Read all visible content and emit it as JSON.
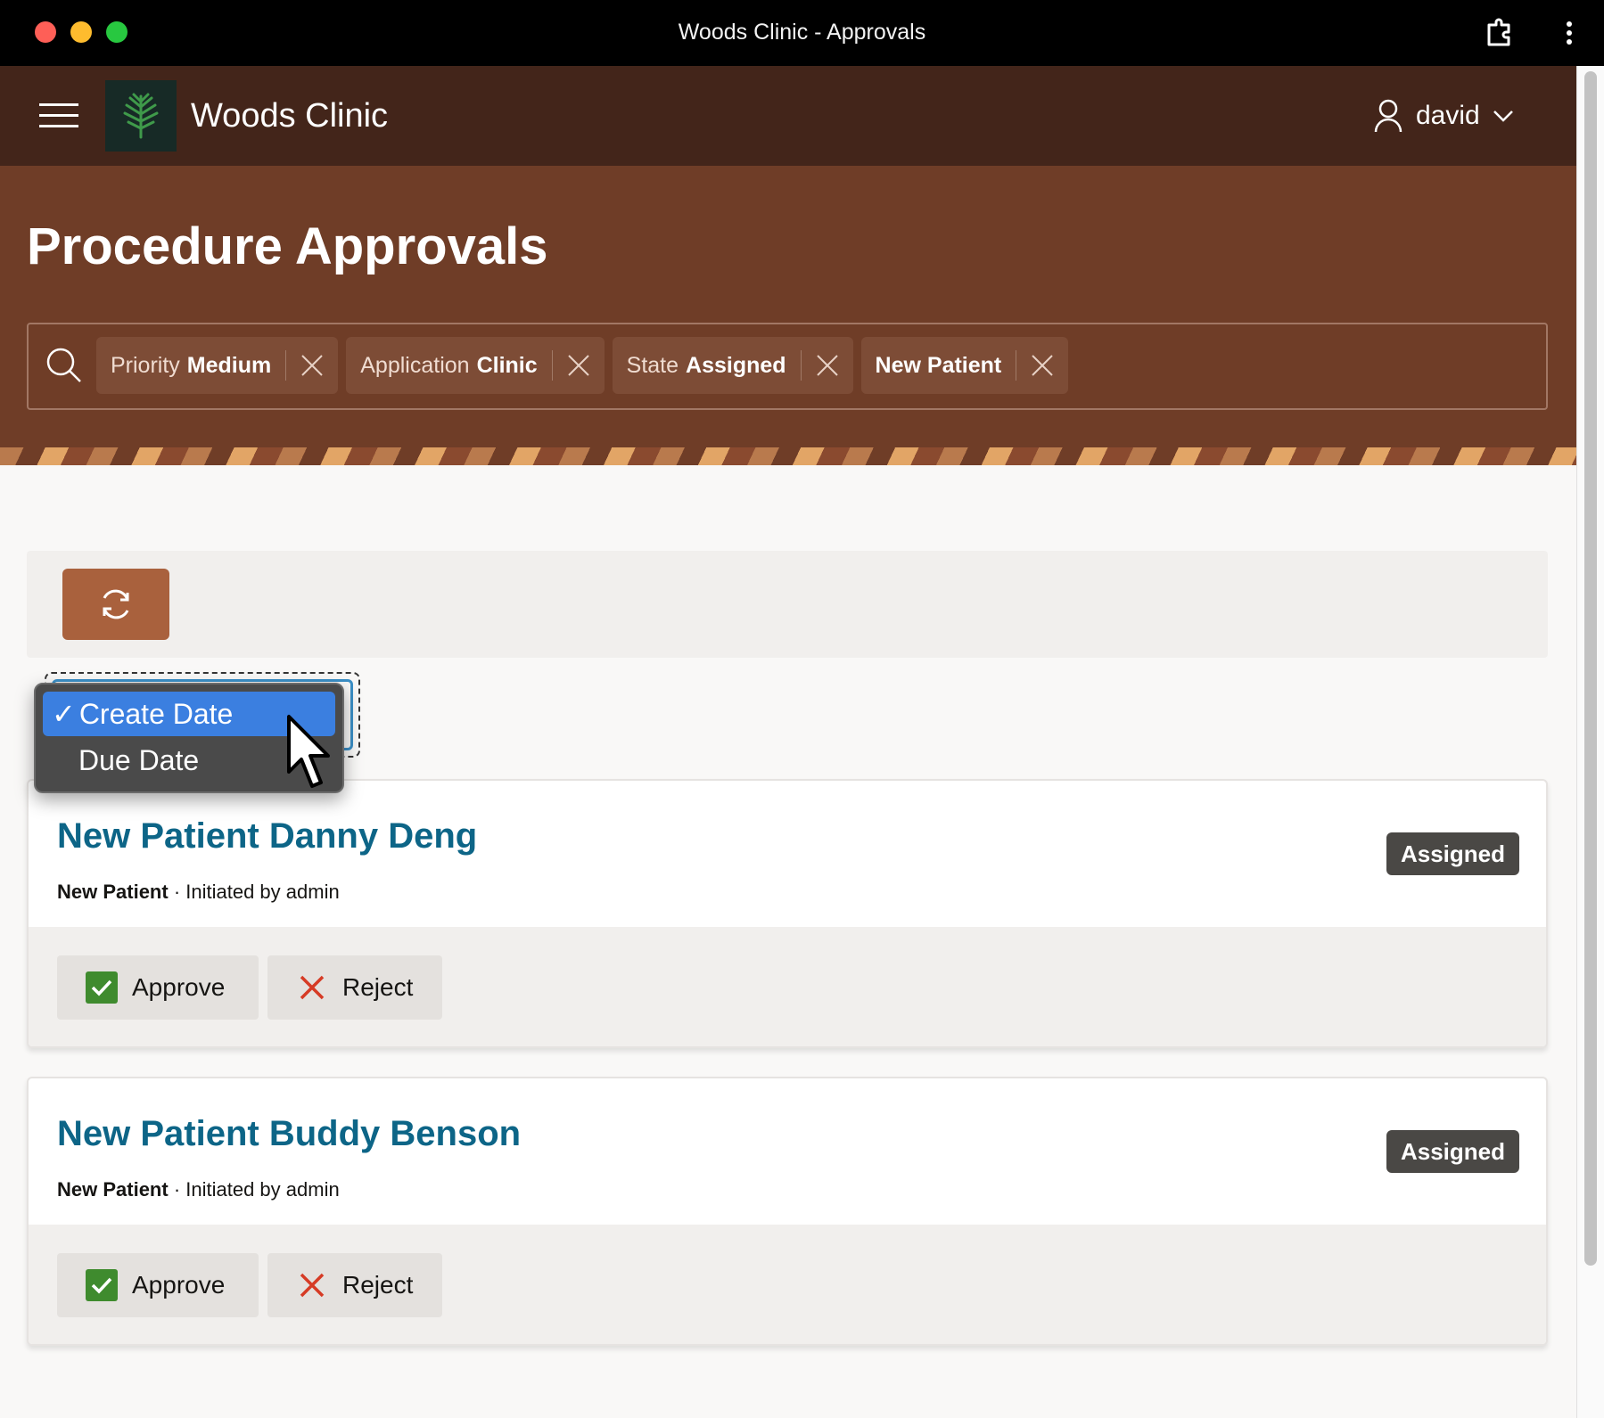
{
  "window": {
    "title": "Woods Clinic - Approvals"
  },
  "app": {
    "name": "Woods Clinic",
    "user": "david"
  },
  "page": {
    "title": "Procedure Approvals"
  },
  "filters": [
    {
      "label": "Priority",
      "value": "Medium"
    },
    {
      "label": "Application",
      "value": "Clinic"
    },
    {
      "label": "State",
      "value": "Assigned"
    },
    {
      "label": "",
      "value": "New Patient"
    }
  ],
  "sort": {
    "options": [
      "Create Date",
      "Due Date"
    ],
    "selected": "Create Date",
    "check": "✓"
  },
  "cards": [
    {
      "title": "New Patient Danny Deng",
      "type": "New Patient",
      "initiated": "· Initiated by admin",
      "status": "Assigned",
      "approve_label": "Approve",
      "reject_label": "Reject"
    },
    {
      "title": "New Patient Buddy Benson",
      "type": "New Patient",
      "initiated": "· Initiated by admin",
      "status": "Assigned",
      "approve_label": "Approve",
      "reject_label": "Reject"
    }
  ],
  "colors": {
    "header": "#43251a",
    "hero": "#6f3d27",
    "accent": "#a9613d",
    "link": "#0d6587",
    "approve": "#3f8b2e",
    "reject": "#d63b25",
    "selection": "#3b7fe0"
  },
  "icons": {
    "menu": "hamburger-icon",
    "logo": "tree-logo-icon",
    "user": "user-icon",
    "search": "search-icon",
    "refresh": "refresh-icon",
    "approve": "check-icon",
    "reject": "x-icon"
  }
}
